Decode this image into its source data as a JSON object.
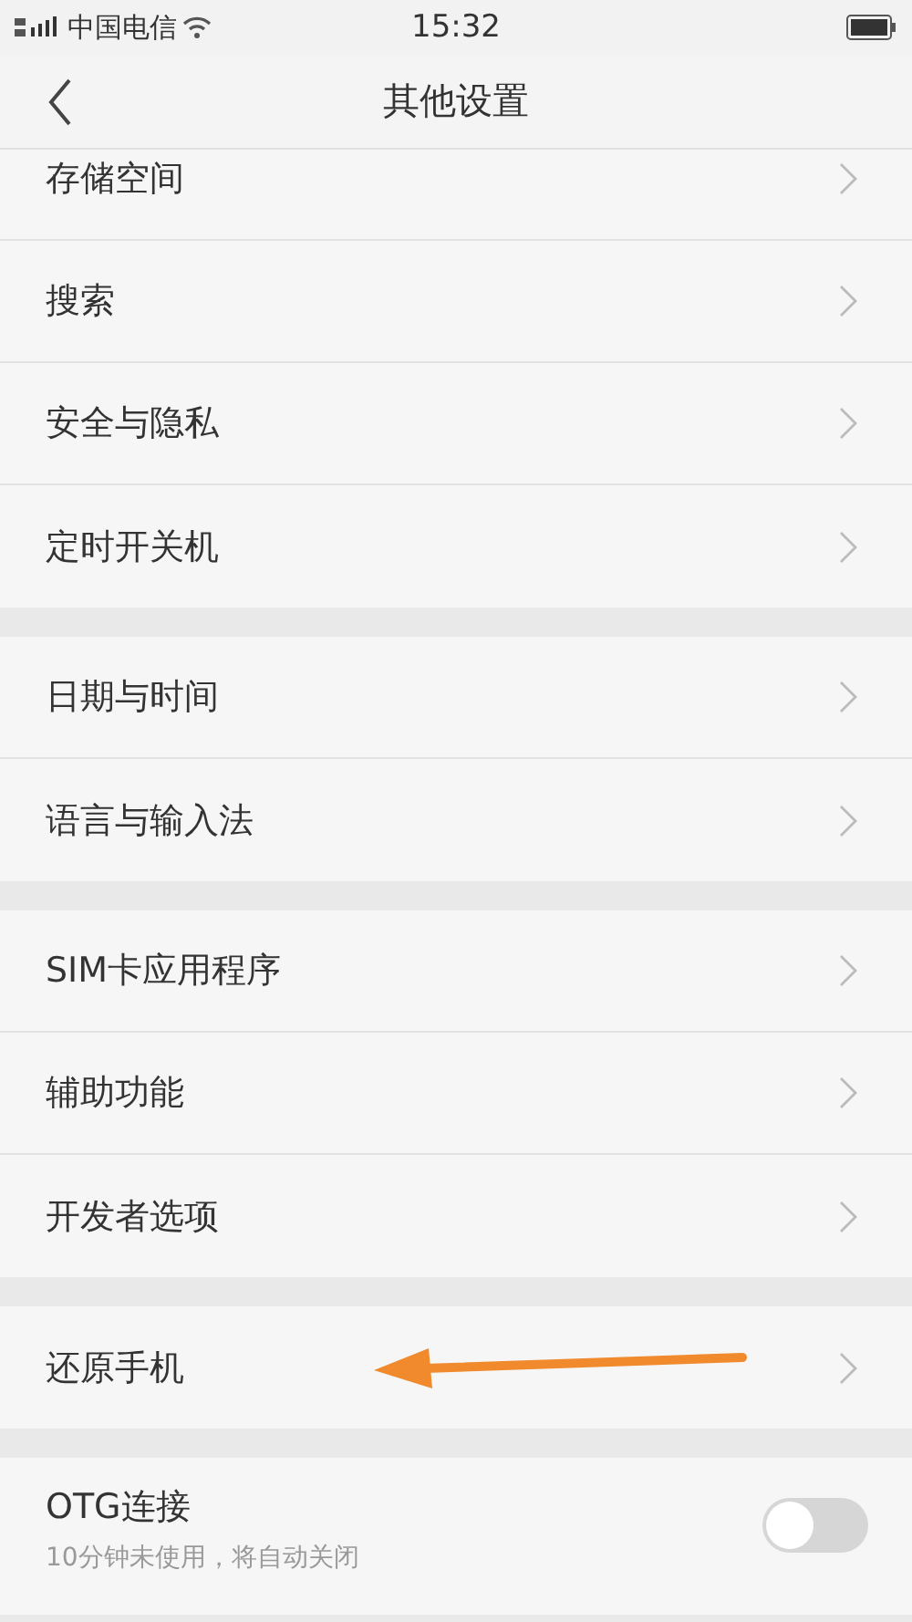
{
  "status_bar": {
    "carrier": "中国电信",
    "time": "15:32"
  },
  "header": {
    "title": "其他设置"
  },
  "groups": [
    {
      "items": [
        {
          "label": "存储空间",
          "kind": "link",
          "highlighted": false
        },
        {
          "label": "搜索",
          "kind": "link",
          "highlighted": false
        },
        {
          "label": "安全与隐私",
          "kind": "link",
          "highlighted": false
        },
        {
          "label": "定时开关机",
          "kind": "link",
          "highlighted": false
        }
      ]
    },
    {
      "items": [
        {
          "label": "日期与时间",
          "kind": "link",
          "highlighted": false
        },
        {
          "label": "语言与输入法",
          "kind": "link",
          "highlighted": false
        }
      ]
    },
    {
      "items": [
        {
          "label": "SIM卡应用程序",
          "kind": "link",
          "highlighted": false
        },
        {
          "label": "辅助功能",
          "kind": "link",
          "highlighted": false
        },
        {
          "label": "开发者选项",
          "kind": "link",
          "highlighted": false
        }
      ]
    },
    {
      "items": [
        {
          "label": "还原手机",
          "kind": "link",
          "highlighted": true
        }
      ]
    },
    {
      "items": [
        {
          "label": "OTG连接",
          "kind": "toggle",
          "subtitle": "10分钟未使用，将自动关闭",
          "on": false
        }
      ]
    }
  ]
}
